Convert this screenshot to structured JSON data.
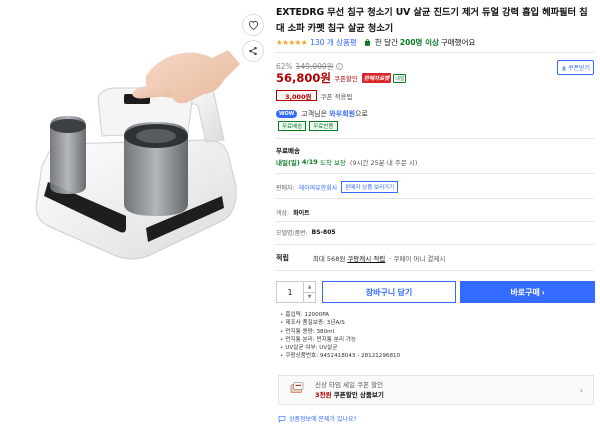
{
  "product": {
    "title": "EXTEDRG 무선 침구 청소기 UV 살균 진드기 제거 듀얼 강력 흡입 헤파필터 침대 소파 카펫 침구 살균 청소기",
    "stars": "★★★★★",
    "review_count": "130 개 상품평",
    "buy_prefix": "한 달간",
    "buy_count": "200명 이상",
    "buy_suffix": "구매했어요"
  },
  "price": {
    "discount_rate": "62%",
    "original_price": "149,000원",
    "info_mark": "i",
    "sale_price": "56,800원",
    "coupon_sale_label": "쿠폰할인",
    "rocket_label": "판매자로켓",
    "today_label": "내일",
    "coupon_download_label": "쿠폰받기",
    "coupon_amount": "3,000원",
    "coupon_applied_label": "쿠폰 적용됨"
  },
  "wow": {
    "badge": "WOW",
    "text_prefix": "고객님은",
    "text_strong": "와우회원",
    "text_suffix": "으로",
    "tags": [
      "무료배송",
      "무료반품"
    ]
  },
  "shipping": {
    "title": "무료배송",
    "day": "내일(일)",
    "date": "4/19",
    "suffix": "도착 보장",
    "note": "(9시간 25분 내 주문 시)"
  },
  "seller": {
    "label": "판매자:",
    "name": "헤이퍼유한회사",
    "more_button": "판매자 상품 보러가기"
  },
  "options": {
    "color_label": "색상:",
    "color_value": "화이트",
    "model_label": "모델명/품번:",
    "model_value": "BS-805"
  },
  "reward": {
    "label": "적립",
    "text": "최대 568원",
    "link": "쿠팡캐시 적립",
    "pay": "· 쿠페이 머니 결제시"
  },
  "purchase": {
    "quantity": "1",
    "up": "▲",
    "down": "▼",
    "cart_label": "장바구니 담기",
    "buy_label": "바로구매",
    "buy_chevron": "›"
  },
  "specs": [
    "흡입력: 12000PA",
    "제조사 품질보증: 3년A/S",
    "먼지통 용량: 380ml",
    "먼지통 분리: 먼지통 분리 가능",
    "UV살균 여부: UV살균",
    "쿠팡상품번호: 9452418043 - 28121296810"
  ],
  "promo": {
    "line1": "신상 타임 세일 쿠폰 할인",
    "amount": "3천원",
    "line2_suffix": "쿠폰할인 상품보기",
    "chevron": "›"
  },
  "report": {
    "text": "상품정보에 문제가 있나요?"
  },
  "colors": {
    "accent": "#346aff",
    "price_red": "#ae0000",
    "green": "#0a7a26",
    "star": "#f5a623"
  },
  "icons": [
    "heart-icon",
    "share-icon",
    "shopping-bag-icon",
    "download-icon",
    "coupon-icon",
    "chat-icon",
    "chevron-right-icon"
  ]
}
